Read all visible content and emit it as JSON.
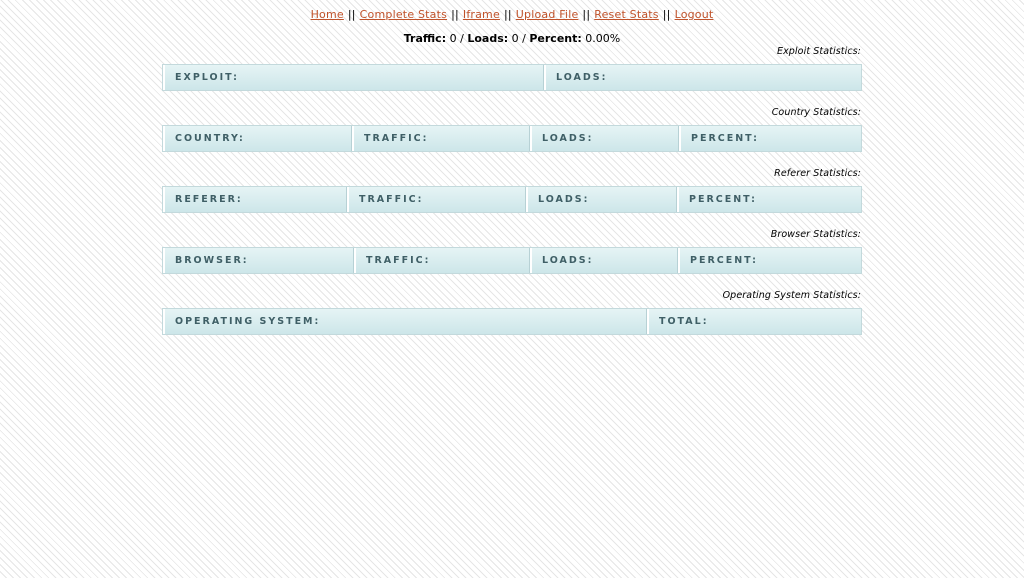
{
  "nav": {
    "links": [
      "Home",
      "Complete Stats",
      "Iframe",
      "Upload File",
      "Reset Stats",
      "Logout"
    ],
    "separator": "||"
  },
  "summary": {
    "traffic_label": "Traffic:",
    "traffic_value": "0",
    "loads_label": "Loads:",
    "loads_value": "0",
    "percent_label": "Percent:",
    "percent_value": "0.00%",
    "divider": "/"
  },
  "exploit": {
    "caption": "Exploit Statistics:",
    "headers": [
      "EXPLOIT:",
      "LOADS:"
    ]
  },
  "country": {
    "caption": "Country Statistics:",
    "headers": [
      "COUNTRY:",
      "TRAFFIC:",
      "LOADS:",
      "PERCENT:"
    ]
  },
  "referer": {
    "caption": "Referer Statistics:",
    "headers": [
      "REFERER:",
      "TRAFFIC:",
      "LOADS:",
      "PERCENT:"
    ]
  },
  "browser": {
    "caption": "Browser Statistics:",
    "headers": [
      "BROWSER:",
      "TRAFFIC:",
      "LOADS:",
      "PERCENT:"
    ]
  },
  "os": {
    "caption": "Operating System Statistics:",
    "headers": [
      "OPERATING SYSTEM:",
      "TOTAL:"
    ]
  },
  "colors": {
    "link": "#c0522a",
    "header_text": "#3f5f66",
    "header_bg_top": "#e6f4f5",
    "header_bg_bottom": "#cde6e9"
  }
}
